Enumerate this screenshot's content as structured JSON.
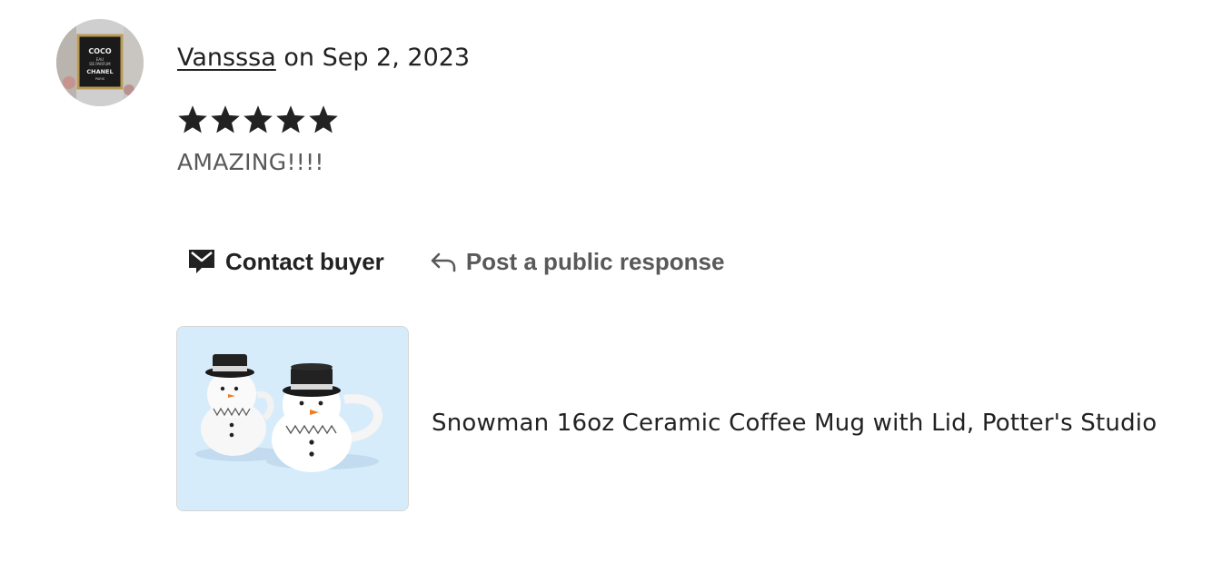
{
  "review": {
    "reviewer_name": "Vansssa",
    "date_text": " on Sep 2, 2023",
    "rating": 5,
    "rating_max": 5,
    "text": "AMAZING!!!!"
  },
  "avatar": {
    "lines": [
      "COCO",
      "EAU",
      "DE PARFUM",
      "CHANEL",
      "PARIS"
    ]
  },
  "actions": {
    "contact_label": "Contact buyer",
    "respond_label": "Post a public response"
  },
  "listing": {
    "title": "Snowman 16oz Ceramic Coffee Mug with Lid, Potter's Studio"
  },
  "colors": {
    "text_primary": "#222222",
    "text_secondary": "#595959",
    "image_background": "#d7ecfb"
  }
}
